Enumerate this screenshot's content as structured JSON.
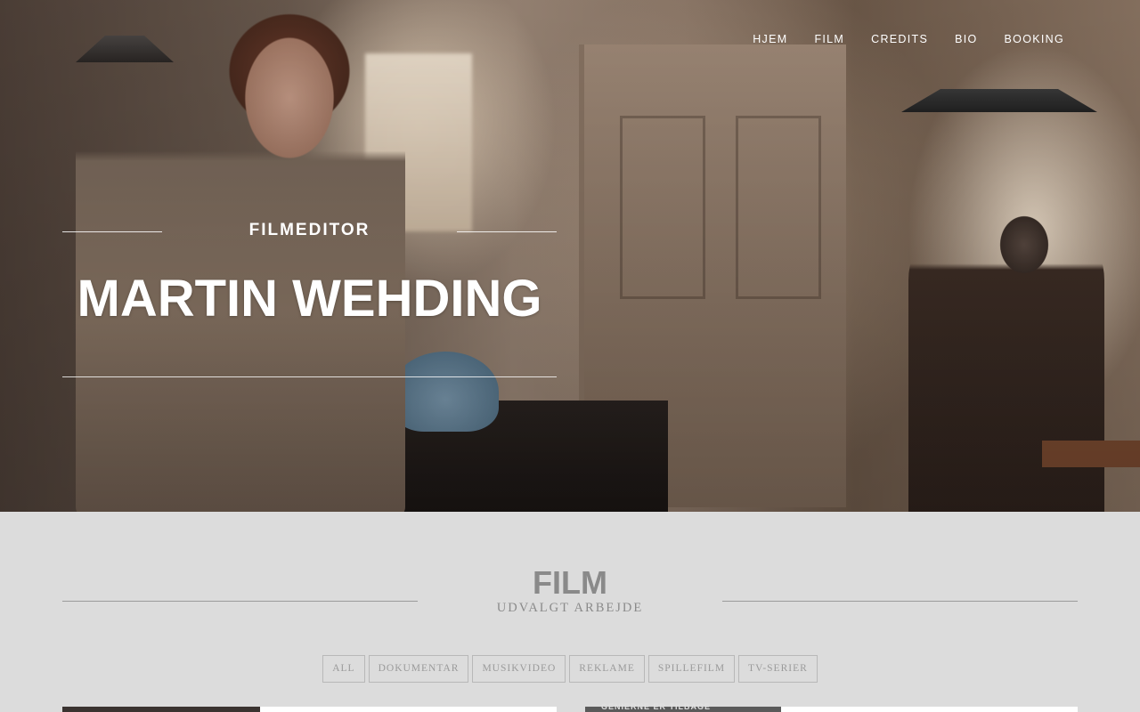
{
  "nav": {
    "items": [
      {
        "label": "HJEM"
      },
      {
        "label": "FILM"
      },
      {
        "label": "CREDITS"
      },
      {
        "label": "BIO"
      },
      {
        "label": "BOOKING"
      }
    ]
  },
  "hero": {
    "subtitle": "FILMEDITOR",
    "name": "MARTIN WEHDING"
  },
  "film_section": {
    "title": "FILM",
    "subtitle": "UDVALGT ARBEJDE",
    "filters": [
      "ALL",
      "DOKUMENTAR",
      "MUSIKVIDEO",
      "REKLAME",
      "SPILLEFILM",
      "TV-SERIER"
    ],
    "thumbnail_caption": "GENIERNE ER TILBAGE"
  },
  "colors": {
    "section_bg": "#dcdcdc",
    "title_gray": "#8a8a8a",
    "nav_text": "#ffffff"
  }
}
